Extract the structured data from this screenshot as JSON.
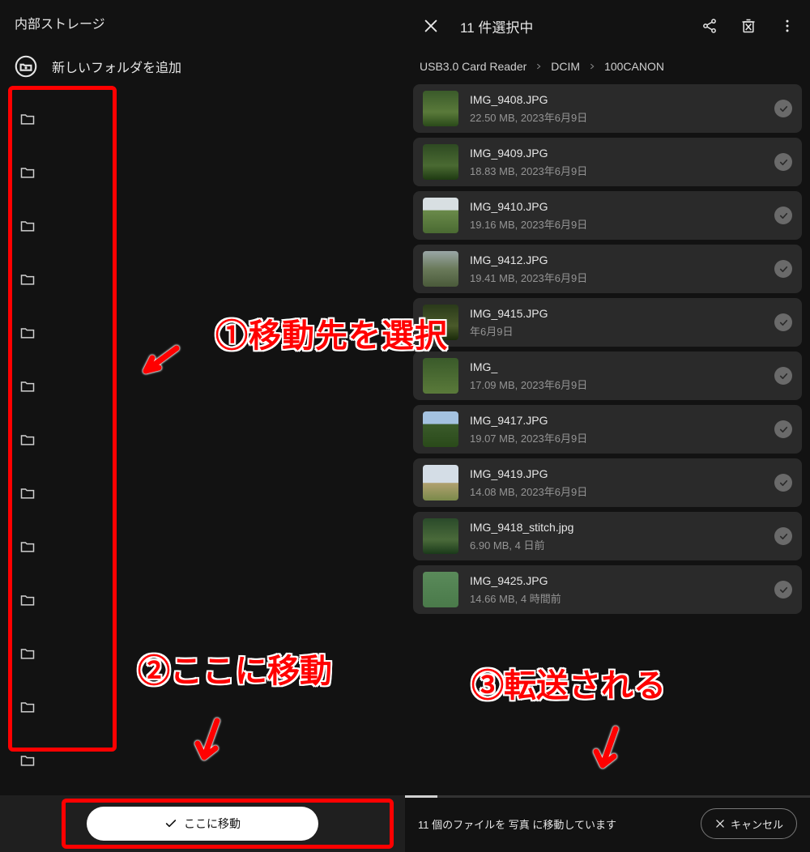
{
  "left": {
    "title": "内部ストレージ",
    "new_folder_label": "新しいフォルダを追加",
    "move_button_label": "ここに移動",
    "folder_count": 13
  },
  "right": {
    "header": {
      "selection_title": "11 件選択中"
    },
    "breadcrumb": [
      "USB3.0 Card Reader",
      "DCIM",
      "100CANON"
    ],
    "files": [
      {
        "name": "IMG_9408.JPG",
        "sub": "22.50 MB, 2023年6月9日"
      },
      {
        "name": "IMG_9409.JPG",
        "sub": "18.83 MB, 2023年6月9日"
      },
      {
        "name": "IMG_9410.JPG",
        "sub": "19.16 MB, 2023年6月9日"
      },
      {
        "name": "IMG_9412.JPG",
        "sub": "19.41 MB, 2023年6月9日"
      },
      {
        "name": "IMG_9415.JPG",
        "sub": "",
        "partial_date": "年6月9日"
      },
      {
        "name": "IMG_",
        "sub": "17.09 MB, 2023年6月9日",
        "name_partial": true
      },
      {
        "name": "IMG_9417.JPG",
        "sub": "19.07 MB, 2023年6月9日"
      },
      {
        "name": "IMG_9419.JPG",
        "sub": "14.08 MB, 2023年6月9日"
      },
      {
        "name": "IMG_9418_stitch.jpg",
        "sub": "6.90 MB, 4 日前"
      },
      {
        "name": "IMG_9425.JPG",
        "sub": "14.66 MB, 4 時間前"
      }
    ],
    "transfer_text": "11 個のファイルを 写真 に移動しています",
    "cancel_label": "キャンセル"
  },
  "annotations": {
    "step1": "①移動先を選択",
    "step2": "②ここに移動",
    "step3": "③転送される"
  }
}
